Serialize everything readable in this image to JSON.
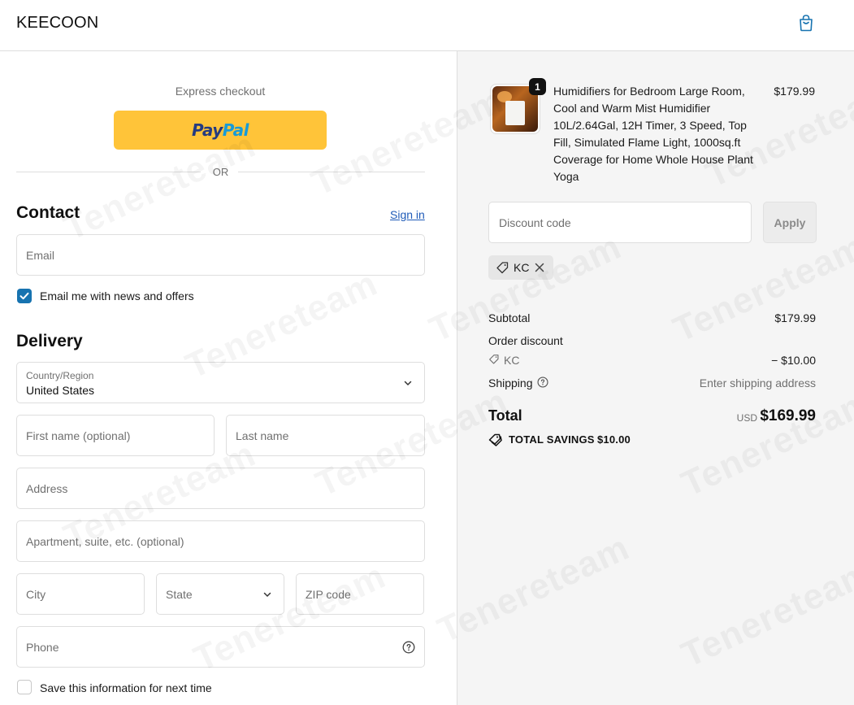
{
  "header": {
    "logo": "KEECOON",
    "cart_icon": "shopping-bag-icon"
  },
  "express": {
    "label": "Express checkout",
    "paypal_pay": "Pay",
    "paypal_pal": "Pal",
    "or_text": "OR"
  },
  "contact": {
    "title": "Contact",
    "sign_in": "Sign in",
    "email_placeholder": "Email",
    "newsletter_label": "Email me with news and offers",
    "newsletter_checked": true
  },
  "delivery": {
    "title": "Delivery",
    "country_label": "Country/Region",
    "country_value": "United States",
    "first_name_placeholder": "First name (optional)",
    "last_name_placeholder": "Last name",
    "address_placeholder": "Address",
    "apartment_placeholder": "Apartment, suite, etc. (optional)",
    "city_placeholder": "City",
    "state_placeholder": "State",
    "zip_placeholder": "ZIP code",
    "phone_placeholder": "Phone",
    "save_info_label": "Save this information for next time",
    "save_info_checked": false
  },
  "summary": {
    "product": {
      "quantity": "1",
      "name": "Humidifiers for Bedroom Large Room, Cool and Warm Mist Humidifier 10L/2.64Gal, 12H Timer, 3 Speed, Top Fill, Simulated Flame Light, 1000sq.ft Coverage for Home Whole House Plant Yoga",
      "price": "$179.99"
    },
    "discount_placeholder": "Discount code",
    "apply_label": "Apply",
    "applied_code": "KC",
    "subtotal_label": "Subtotal",
    "subtotal_value": "$179.99",
    "order_discount_label": "Order discount",
    "discount_code_label": "KC",
    "discount_value": "− $10.00",
    "shipping_label": "Shipping",
    "shipping_value": "Enter shipping address",
    "total_label": "Total",
    "total_currency": "USD",
    "total_value": "$169.99",
    "savings_label": "TOTAL SAVINGS",
    "savings_value": "$10.00"
  },
  "watermark": "Tenereteam",
  "colors": {
    "paypal_yellow": "#ffc439",
    "link_blue": "#1f5bb8",
    "checkbox_blue": "#1773b0",
    "summary_bg": "#f5f5f5"
  }
}
